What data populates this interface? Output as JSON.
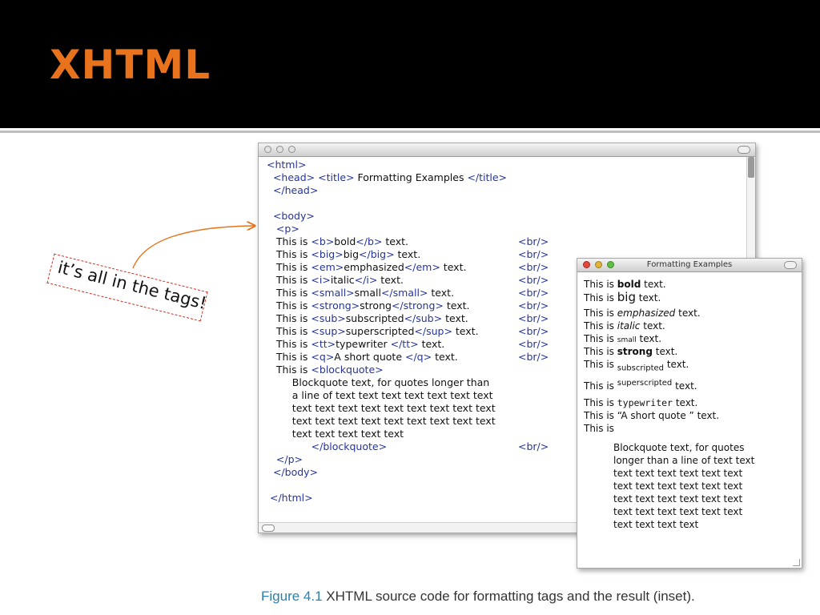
{
  "slide": {
    "title": "XHTML"
  },
  "callout": {
    "text": "it’s all in the tags!"
  },
  "code_window": {
    "lines": [
      [
        {
          "t": "<html>",
          "k": "tag"
        }
      ],
      [
        {
          "t": "  "
        },
        {
          "t": "<head>",
          "k": "tag"
        },
        {
          "t": " "
        },
        {
          "t": "<title>",
          "k": "tag"
        },
        {
          "t": " Formatting Examples "
        },
        {
          "t": "</title>",
          "k": "tag"
        }
      ],
      [
        {
          "t": "  "
        },
        {
          "t": "</head>",
          "k": "tag"
        }
      ],
      [],
      [
        {
          "t": "  "
        },
        {
          "t": "<body>",
          "k": "tag"
        }
      ],
      [
        {
          "t": "   "
        },
        {
          "t": "<p>",
          "k": "tag"
        }
      ],
      [
        {
          "t": "   This is "
        },
        {
          "t": "<b>",
          "k": "tag"
        },
        {
          "t": "bold"
        },
        {
          "t": "</b>",
          "k": "tag"
        },
        {
          "t": " text."
        }
      ],
      [
        {
          "t": "   This is "
        },
        {
          "t": "<big>",
          "k": "tag"
        },
        {
          "t": "big"
        },
        {
          "t": "</big>",
          "k": "tag"
        },
        {
          "t": " text."
        }
      ],
      [
        {
          "t": "   This is "
        },
        {
          "t": "<em>",
          "k": "tag"
        },
        {
          "t": "emphasized"
        },
        {
          "t": "</em>",
          "k": "tag"
        },
        {
          "t": " text."
        }
      ],
      [
        {
          "t": "   This is "
        },
        {
          "t": "<i>",
          "k": "tag"
        },
        {
          "t": "italic"
        },
        {
          "t": "</i>",
          "k": "tag"
        },
        {
          "t": " text."
        }
      ],
      [
        {
          "t": "   This is "
        },
        {
          "t": "<small>",
          "k": "tag"
        },
        {
          "t": "small"
        },
        {
          "t": "</small>",
          "k": "tag"
        },
        {
          "t": " text."
        }
      ],
      [
        {
          "t": "   This is "
        },
        {
          "t": "<strong>",
          "k": "tag"
        },
        {
          "t": "strong"
        },
        {
          "t": "</strong>",
          "k": "tag"
        },
        {
          "t": " text."
        }
      ],
      [
        {
          "t": "   This is "
        },
        {
          "t": "<sub>",
          "k": "tag"
        },
        {
          "t": "subscripted"
        },
        {
          "t": "</sub>",
          "k": "tag"
        },
        {
          "t": " text."
        }
      ],
      [
        {
          "t": "   This is "
        },
        {
          "t": "<sup>",
          "k": "tag"
        },
        {
          "t": "superscripted"
        },
        {
          "t": "</sup>",
          "k": "tag"
        },
        {
          "t": " text."
        }
      ],
      [
        {
          "t": "   This is "
        },
        {
          "t": "<tt>",
          "k": "tag"
        },
        {
          "t": "typewriter "
        },
        {
          "t": "</tt>",
          "k": "tag"
        },
        {
          "t": " text."
        }
      ],
      [
        {
          "t": "   This is "
        },
        {
          "t": "<q>",
          "k": "tag"
        },
        {
          "t": "A short quote "
        },
        {
          "t": "</q>",
          "k": "tag"
        },
        {
          "t": " text."
        }
      ],
      [
        {
          "t": "   This is "
        },
        {
          "t": "<blockquote>",
          "k": "tag"
        }
      ],
      [
        {
          "t": "        Blockquote text, for quotes longer than"
        }
      ],
      [
        {
          "t": "        a line of text text text text text text text"
        }
      ],
      [
        {
          "t": "        text text text text text text text text text"
        }
      ],
      [
        {
          "t": "        text text text text text text text text text"
        }
      ],
      [
        {
          "t": "        text text text text text"
        }
      ],
      [
        {
          "t": "              "
        },
        {
          "t": "</blockquote>",
          "k": "tag"
        }
      ],
      [
        {
          "t": "   "
        },
        {
          "t": "</p>",
          "k": "tag"
        }
      ],
      [
        {
          "t": "  "
        },
        {
          "t": "</body>",
          "k": "tag"
        }
      ],
      [],
      [
        {
          "t": " "
        },
        {
          "t": "</html>",
          "k": "tag"
        }
      ]
    ],
    "br_tag": "<br/>",
    "br_lines": [
      6,
      7,
      8,
      9,
      10,
      11,
      12,
      13,
      14,
      15,
      22
    ]
  },
  "result_window": {
    "title": "Formatting Examples",
    "lines": [
      [
        {
          "t": "This is "
        },
        {
          "t": "bold",
          "s": "b"
        },
        {
          "t": " text."
        }
      ],
      [
        {
          "t": "This is "
        },
        {
          "t": "big",
          "s": "big"
        },
        {
          "t": " text."
        }
      ],
      [
        {
          "t": "This is "
        },
        {
          "t": "emphasized",
          "s": "i"
        },
        {
          "t": " text."
        }
      ],
      [
        {
          "t": "This is "
        },
        {
          "t": "italic",
          "s": "i"
        },
        {
          "t": " text."
        }
      ],
      [
        {
          "t": "This is "
        },
        {
          "t": "small",
          "s": "small"
        },
        {
          "t": " text."
        }
      ],
      [
        {
          "t": "This is "
        },
        {
          "t": "strong",
          "s": "b"
        },
        {
          "t": " text."
        }
      ],
      [
        {
          "t": "This is "
        },
        {
          "t": "subscripted",
          "s": "sub"
        },
        {
          "t": " text."
        }
      ],
      [
        {
          "t": "This is "
        },
        {
          "t": "superscripted",
          "s": "sup"
        },
        {
          "t": " text."
        }
      ],
      [
        {
          "t": "This is "
        },
        {
          "t": "typewriter",
          "s": "tt"
        },
        {
          "t": " text."
        }
      ],
      [
        {
          "t": "This is “A short quote ” text."
        }
      ],
      [
        {
          "t": "This is"
        }
      ]
    ],
    "blockquote_lines": [
      "Blockquote text, for quotes",
      "longer than a line of text text",
      "text text text text text text",
      "text text text text text text",
      "text text text text text text",
      "text text text text text text",
      "text text text text"
    ]
  },
  "caption": {
    "figure": "Figure 4.1",
    "text": "XHTML source code for formatting tags and the result (inset)."
  }
}
